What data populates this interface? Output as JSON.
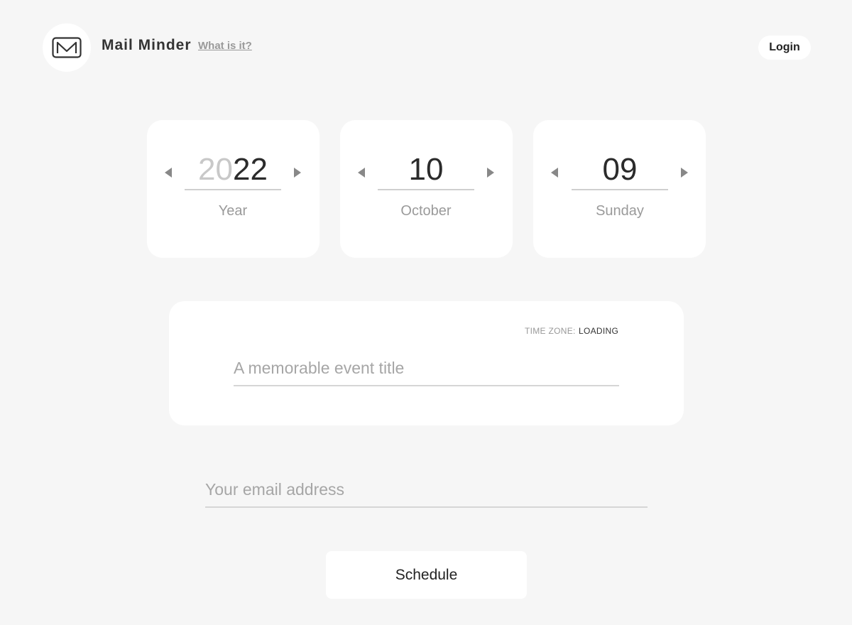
{
  "header": {
    "brand_name": "Mail Minder",
    "what_is_it_label": "What is it?",
    "login_label": "Login",
    "logo_icon": "envelope-icon"
  },
  "date_picker": {
    "year": {
      "value_prefix": "20",
      "value_suffix": "22",
      "label": "Year"
    },
    "month": {
      "value": "10",
      "label": "October"
    },
    "day": {
      "value": "09",
      "label": "Sunday"
    }
  },
  "event": {
    "timezone_label": "TIME ZONE:",
    "timezone_value": "LOADING",
    "title_placeholder": "A memorable event title"
  },
  "email": {
    "placeholder": "Your email address"
  },
  "actions": {
    "schedule_label": "Schedule"
  },
  "colors": {
    "background": "#f6f6f6",
    "card": "#ffffff"
  }
}
